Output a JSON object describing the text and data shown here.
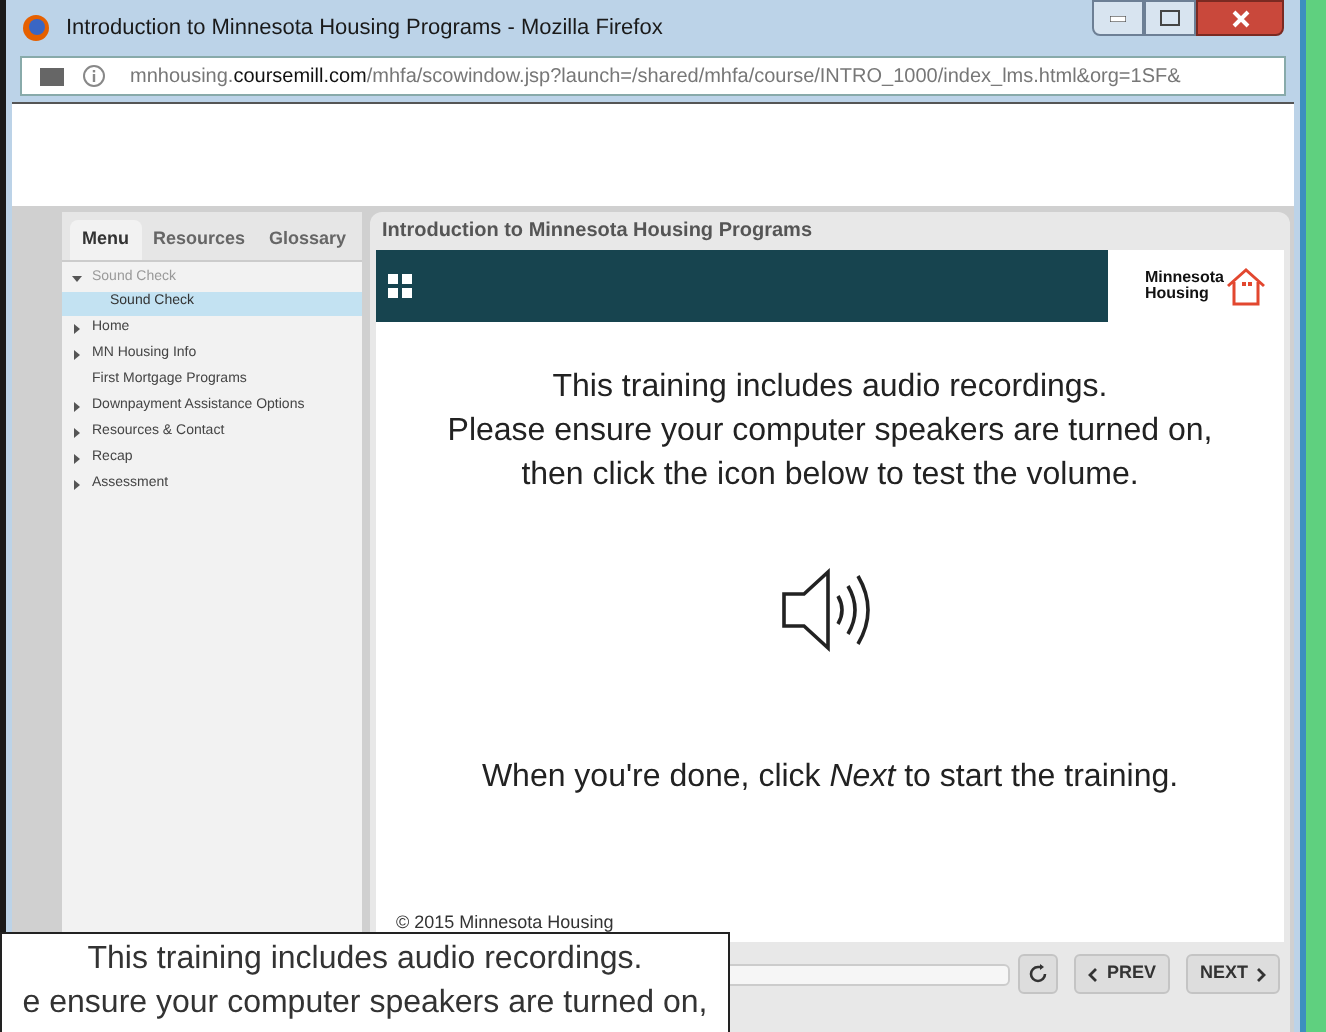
{
  "window": {
    "title": "Introduction to Minnesota Housing Programs - Mozilla Firefox"
  },
  "address_bar": {
    "url_prefix": "mnhousing.",
    "url_domain": "coursemill.com",
    "url_path": "/mhfa/scowindow.jsp?launch=/shared/mhfa/course/INTRO_1000/index_lms.html&org=1SF&"
  },
  "sidebar": {
    "tabs": [
      {
        "label": "Menu",
        "selected": true
      },
      {
        "label": "Resources",
        "selected": false
      },
      {
        "label": "Glossary",
        "selected": false
      }
    ],
    "items": [
      {
        "label": "Sound Check",
        "expandable": true,
        "expanded": true,
        "children": [
          {
            "label": "Sound Check",
            "selected": true
          }
        ]
      },
      {
        "label": "Home",
        "expandable": true,
        "expanded": false
      },
      {
        "label": "MN Housing Info",
        "expandable": true,
        "expanded": false
      },
      {
        "label": "First Mortgage Programs",
        "expandable": false,
        "expanded": false
      },
      {
        "label": "Downpayment Assistance Options",
        "expandable": true,
        "expanded": false
      },
      {
        "label": "Resources & Contact",
        "expandable": true,
        "expanded": false
      },
      {
        "label": "Recap",
        "expandable": true,
        "expanded": false
      },
      {
        "label": "Assessment",
        "expandable": true,
        "expanded": false
      }
    ]
  },
  "course": {
    "title": "Introduction to Minnesota Housing Programs",
    "logo": [
      "Minnesota",
      "Housing"
    ],
    "lines": [
      "This training includes audio recordings.",
      "Please ensure your computer speakers are turned on,",
      "then click the icon below to test the volume."
    ],
    "done_text": "When you're done, click *Next* to start the training.",
    "footer": "© 2015 Minnesota Housing",
    "nav": {
      "prev": "PREV",
      "next": "NEXT"
    }
  },
  "caption": {
    "lines": [
      "This training includes audio recordings.",
      "e ensure your computer speakers are turned on,"
    ]
  }
}
